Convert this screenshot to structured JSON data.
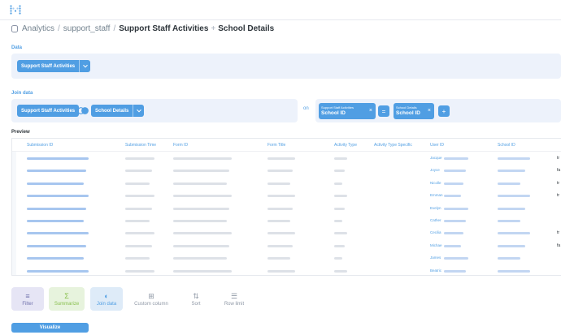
{
  "header": {
    "crumb_root": "Analytics",
    "crumb_schema": "support_staff",
    "crumb_table": "Support Staff Activities",
    "crumb_join": "School Details"
  },
  "data_section": {
    "label": "Data",
    "table_pill": "Support Staff Activities"
  },
  "join_section": {
    "label": "Join data",
    "left_table": "Support Staff Activities",
    "right_table": "School Details",
    "on_label": "on",
    "left_key_small": "Support Staff Activities",
    "left_key": "School ID",
    "operator": "=",
    "right_key_small": "School Details",
    "right_key": "School ID",
    "add_label": "+"
  },
  "preview": {
    "label": "Preview",
    "columns": [
      "Submission ID",
      "Submission Time",
      "Form ID",
      "Form Title",
      "Activity Type",
      "Activity Type Specific",
      "User ID",
      "School ID"
    ],
    "user_names": [
      "Jacque",
      "Joyce",
      "Nicolle",
      "Emman",
      "Evelyn",
      "Cather",
      "Cecilia",
      "Michae",
      "James",
      "Beatric"
    ],
    "tail_values": [
      "tr",
      "fa",
      "tr",
      "tr",
      "",
      "",
      "tr",
      "fa",
      "",
      ""
    ]
  },
  "actions": {
    "filter": "Filter",
    "summarize": "Summarize",
    "join": "Join data",
    "custom_column": "Custom column",
    "sort": "Sort",
    "row_limit": "Row limit"
  },
  "visualize_label": "Visualize",
  "colors": {
    "brand": "#509ee3",
    "well": "#edf2fb",
    "filter_bg": "#e6e5f5",
    "summarize_bg": "#e7f3dd",
    "join_bg": "#deebf8"
  }
}
